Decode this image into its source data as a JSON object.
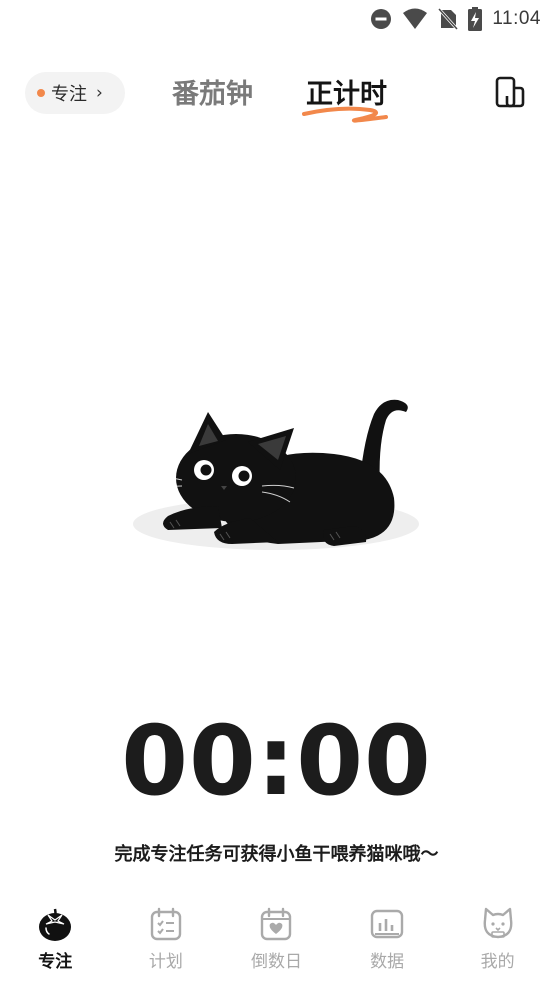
{
  "status_bar": {
    "time": "11:04"
  },
  "top_nav": {
    "focus_pill_label": "专注",
    "tabs": [
      {
        "label": "番茄钟",
        "active": false
      },
      {
        "label": "正计时",
        "active": true
      }
    ],
    "accent_color": "#f2884b"
  },
  "timer": {
    "display": "00:00"
  },
  "hint": "完成专注任务可获得小鱼干喂养猫咪哦～",
  "bottom_nav": {
    "items": [
      {
        "label": "专注",
        "icon": "tomato-icon",
        "active": true
      },
      {
        "label": "计划",
        "icon": "calendar-checklist-icon",
        "active": false
      },
      {
        "label": "倒数日",
        "icon": "calendar-heart-icon",
        "active": false
      },
      {
        "label": "数据",
        "icon": "bar-chart-icon",
        "active": false
      },
      {
        "label": "我的",
        "icon": "cat-face-icon",
        "active": false
      }
    ]
  }
}
